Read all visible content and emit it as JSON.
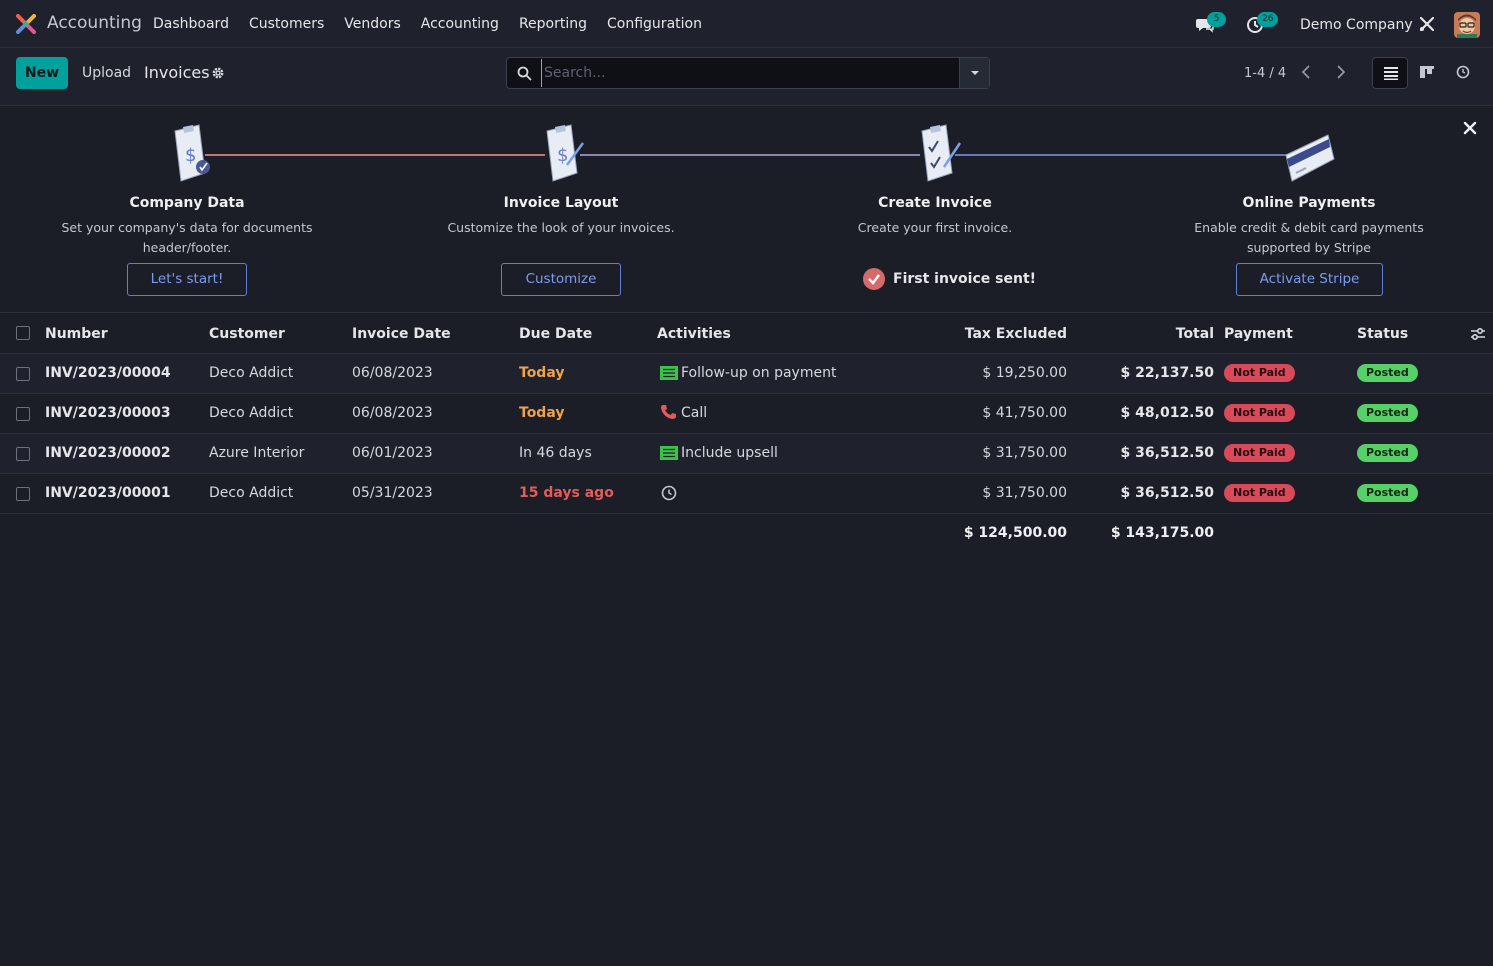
{
  "navbar": {
    "app_name": "Accounting",
    "menu": [
      "Dashboard",
      "Customers",
      "Vendors",
      "Accounting",
      "Reporting",
      "Configuration"
    ],
    "messages_count": "5",
    "activities_count": "26",
    "company": "Demo Company"
  },
  "control": {
    "new_label": "New",
    "upload_label": "Upload",
    "title": "Invoices",
    "search_placeholder": "Search...",
    "pager": "1-4 / 4"
  },
  "onboarding": {
    "steps": [
      {
        "title": "Company Data",
        "description": "Set your company's data for documents header/footer.",
        "button": "Let's start!"
      },
      {
        "title": "Invoice Layout",
        "description": "Customize the look of your invoices.",
        "button": "Customize"
      },
      {
        "title": "Create Invoice",
        "description": "Create your first invoice.",
        "done": "First invoice sent!"
      },
      {
        "title": "Online Payments",
        "description": "Enable credit & debit card payments supported by Stripe",
        "button": "Activate Stripe"
      }
    ]
  },
  "table": {
    "headers": {
      "number": "Number",
      "customer": "Customer",
      "invoice_date": "Invoice Date",
      "due_date": "Due Date",
      "activities": "Activities",
      "tax_excluded": "Tax Excluded",
      "total": "Total",
      "payment": "Payment",
      "status": "Status"
    },
    "rows": [
      {
        "number": "INV/2023/00004",
        "customer": "Deco Addict",
        "invoice_date": "06/08/2023",
        "due_date": "Today",
        "activity": "Follow-up on payment",
        "activity_icon": "todo-icon",
        "tax_excluded": "$ 19,250.00",
        "total": "$ 22,137.50",
        "payment": "Not Paid",
        "status": "Posted"
      },
      {
        "number": "INV/2023/00003",
        "customer": "Deco Addict",
        "invoice_date": "06/08/2023",
        "due_date": "Today",
        "activity": "Call",
        "activity_icon": "phone-icon",
        "tax_excluded": "$ 41,750.00",
        "total": "$ 48,012.50",
        "payment": "Not Paid",
        "status": "Posted"
      },
      {
        "number": "INV/2023/00002",
        "customer": "Azure Interior",
        "invoice_date": "06/01/2023",
        "due_date": "In 46 days",
        "activity": "Include upsell",
        "activity_icon": "todo-icon",
        "tax_excluded": "$ 31,750.00",
        "total": "$ 36,512.50",
        "payment": "Not Paid",
        "status": "Posted"
      },
      {
        "number": "INV/2023/00001",
        "customer": "Deco Addict",
        "invoice_date": "05/31/2023",
        "due_date": "15 days ago",
        "activity": "",
        "activity_icon": "clock-icon",
        "tax_excluded": "$ 31,750.00",
        "total": "$ 36,512.50",
        "payment": "Not Paid",
        "status": "Posted"
      }
    ],
    "totals": {
      "tax_excluded": "$ 124,500.00",
      "total": "$ 143,175.00"
    }
  },
  "colors": {
    "accent": "#00a09d",
    "not_paid": "#d8495a",
    "posted": "#58d068",
    "due_today": "#f0a14b",
    "overdue": "#e45b5b"
  }
}
